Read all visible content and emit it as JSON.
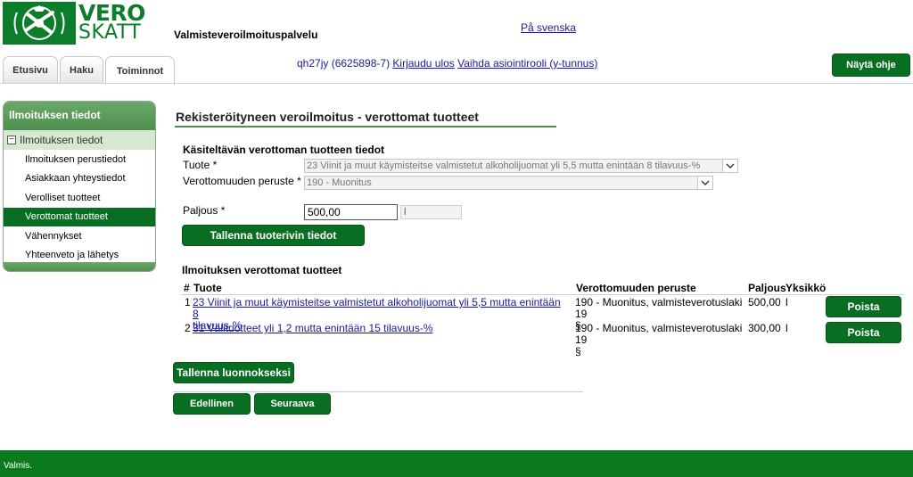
{
  "header": {
    "logo_top": "VERO",
    "logo_bottom": "SKATT",
    "service_name": "Valmisteveroilmoituspalvelu",
    "language_link": "På svenska",
    "user_id": "qh27jy (6625898-7)",
    "logout_link": "Kirjaudu ulos",
    "switch_role_link": "Vaihda asiointirooli (y-tunnus)",
    "help_button": "Näytä ohje"
  },
  "tabs": [
    {
      "label": "Etusivu",
      "active": false
    },
    {
      "label": "Haku",
      "active": false
    },
    {
      "label": "Toiminnot",
      "active": true
    }
  ],
  "sidebar": {
    "header": "Ilmoituksen tiedot",
    "group": "Ilmoituksen tiedot",
    "items": [
      {
        "label": "Ilmoituksen perustiedot",
        "active": false
      },
      {
        "label": "Asiakkaan yhteystiedot",
        "active": false
      },
      {
        "label": "Verolliset tuotteet",
        "active": false
      },
      {
        "label": "Verottomat tuotteet",
        "active": true
      },
      {
        "label": "Vähennykset",
        "active": false
      },
      {
        "label": "Yhteenveto ja lähetys",
        "active": false
      }
    ]
  },
  "main": {
    "page_title": "Rekisteröityneen veroilmoitus - verottomat tuotteet",
    "form": {
      "section_title": "Käsiteltävän verottoman tuotteen tiedot",
      "product_label": "Tuote *",
      "product_value": "23 Viinit ja muut käymisteitse valmistetut alkoholijuomat yli 5,5 mutta enintään 8 tilavuus-%",
      "basis_label": "Verottomuuden peruste *",
      "basis_value": "190 - Muonitus",
      "amount_label": "Paljous *",
      "amount_value": "500,00",
      "unit_value": "l",
      "save_row_button": "Tallenna tuoterivin tiedot"
    },
    "list": {
      "title": "Ilmoituksen verottomat tuotteet",
      "headers": {
        "num": "#",
        "product": "Tuote",
        "basis": "Verottomuuden peruste",
        "amount": "Paljous",
        "unit": "Yksikkö"
      },
      "rows": [
        {
          "num": "1",
          "product_line1": "23 Viinit ja muut käymisteitse valmistetut alkoholijuomat yli 5,5 mutta enintään 8",
          "product_line2": "tilavuus-%",
          "basis_line1": "190 - Muonitus, valmisteverotuslaki 19",
          "basis_line2": "§",
          "amount": "500,00",
          "unit": "l",
          "delete_button": "Poista"
        },
        {
          "num": "2",
          "product_line1": "31 Välituotteet yli 1,2 mutta enintään 15 tilavuus-%",
          "basis_line1": "190 - Muonitus, valmisteverotuslaki 19",
          "basis_line2": "§",
          "amount": "300,00",
          "unit": "l",
          "delete_button": "Poista"
        }
      ]
    },
    "save_draft_button": "Tallenna luonnokseksi",
    "previous_button": "Edellinen",
    "next_button": "Seuraava"
  },
  "statusbar": {
    "text": "Valmis."
  },
  "colors": {
    "brand_green": "#0a6e22",
    "link_blue": "#1a1a9c",
    "status_green": "#0a7a1c"
  },
  "icons": [
    "vero-logo-icon",
    "minus-box-icon",
    "chevron-down-icon"
  ]
}
